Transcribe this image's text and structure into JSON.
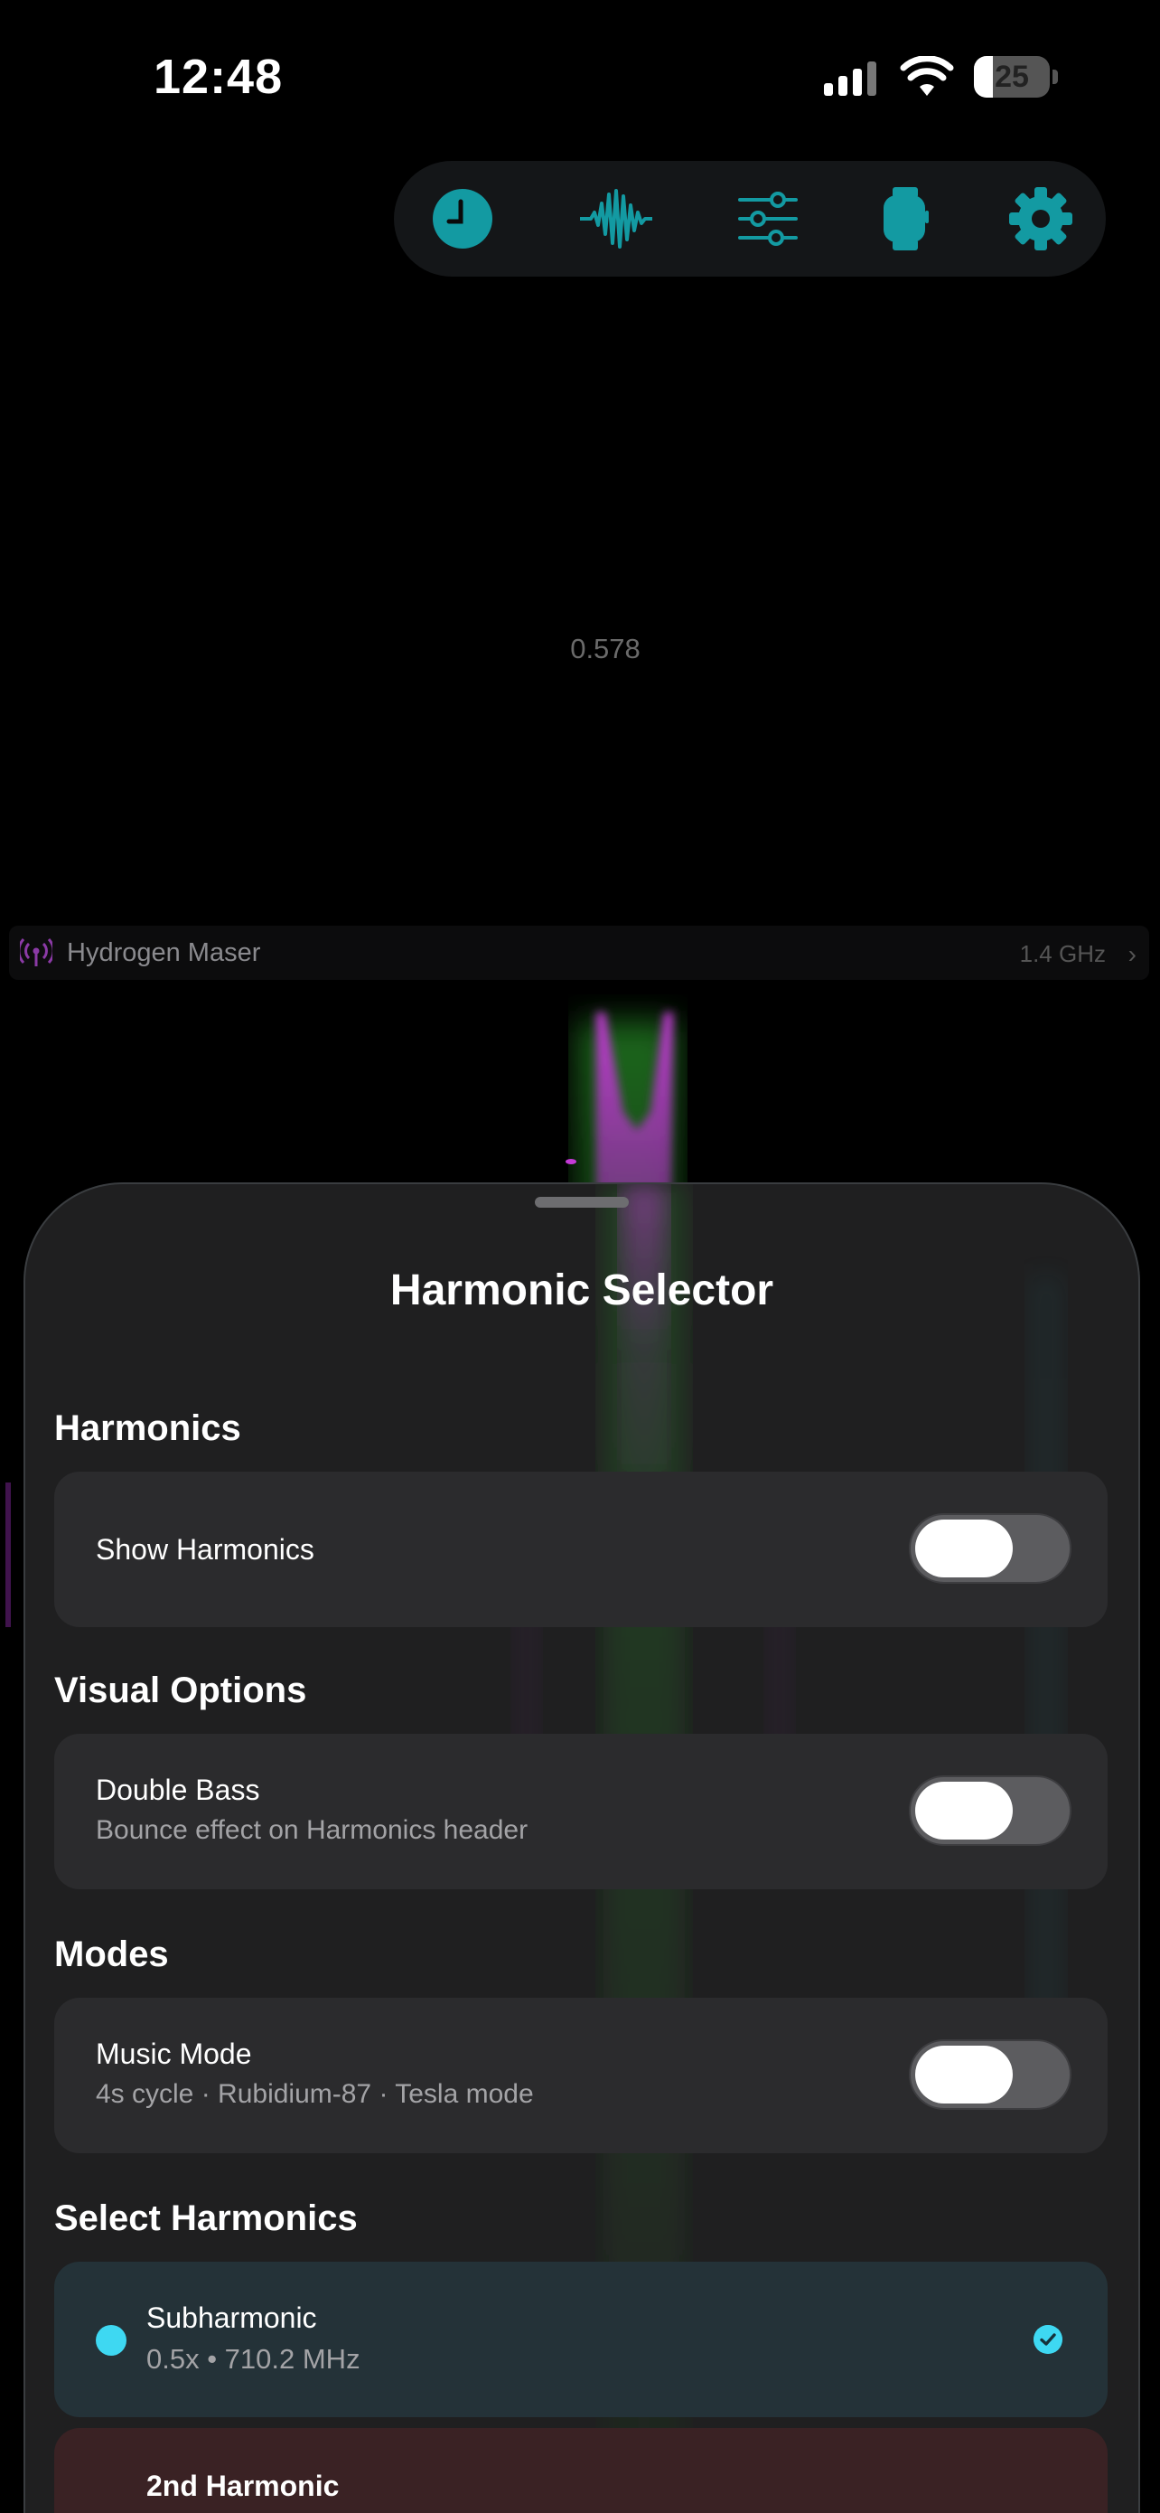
{
  "status_bar": {
    "time": "12:48",
    "battery_percent": "25",
    "battery_level": 0.25
  },
  "toolbar": {
    "items": [
      {
        "name": "clock-icon",
        "active": true
      },
      {
        "name": "waveform-icon",
        "active": false
      },
      {
        "name": "sliders-icon",
        "active": false
      },
      {
        "name": "watch-icon",
        "active": false
      },
      {
        "name": "gear-icon",
        "active": false
      }
    ],
    "accent": "#139aa2"
  },
  "reading": {
    "value": "0.578"
  },
  "source": {
    "icon": "antenna-icon",
    "name": "Hydrogen Maser",
    "frequency": "1.4 GHz",
    "accent": "#8b3aa6"
  },
  "sheet": {
    "title": "Harmonic Selector",
    "sections": {
      "harmonics": {
        "title": "Harmonics",
        "toggle_label": "Show Harmonics",
        "enabled": false
      },
      "visual_options": {
        "title": "Visual Options",
        "toggle_label": "Double Bass",
        "toggle_subtitle": "Bounce effect on Harmonics header",
        "enabled": false
      },
      "modes": {
        "title": "Modes",
        "toggle_label": "Music Mode",
        "toggle_subtitle": "4s cycle · Rubidium-87 · Tesla mode",
        "enabled": false
      },
      "select_harmonics": {
        "title": "Select Harmonics",
        "items": [
          {
            "name": "Subharmonic",
            "detail": "0.5x • 710.2 MHz",
            "selected": true,
            "color": "#3ed8f2"
          },
          {
            "name": "2nd Harmonic",
            "detail": "",
            "selected": false,
            "color": "#c0404a"
          }
        ]
      }
    }
  }
}
